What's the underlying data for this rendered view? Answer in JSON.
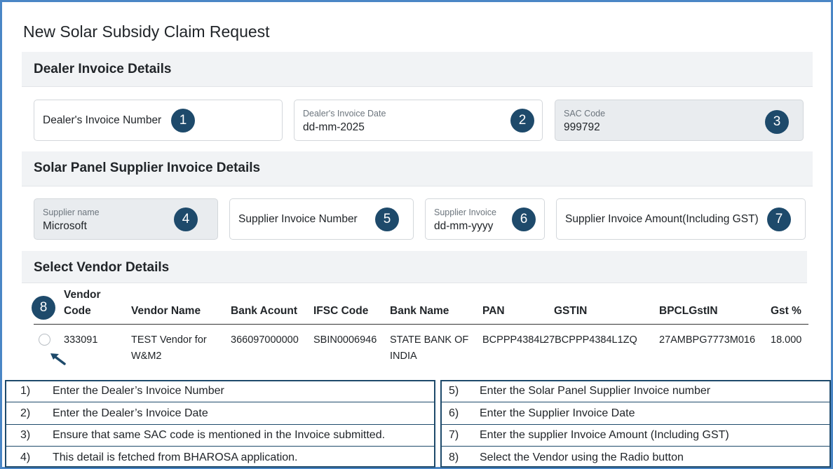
{
  "page": {
    "title": "New Solar Subsidy Claim Request"
  },
  "dealer": {
    "section_title": "Dealer Invoice Details",
    "invoice_number": {
      "placeholder": "Dealer's Invoice Number",
      "badge": "1"
    },
    "invoice_date": {
      "label": "Dealer's Invoice Date",
      "value": "dd-mm-2025",
      "badge": "2"
    },
    "sac_code": {
      "label": "SAC Code",
      "value": "999792",
      "badge": "3"
    }
  },
  "supplier": {
    "section_title": "Solar Panel Supplier Invoice Details",
    "name": {
      "label": "Supplier name",
      "value": "Microsoft",
      "badge": "4"
    },
    "invoice_number": {
      "placeholder": "Supplier Invoice Number",
      "badge": "5"
    },
    "invoice_date": {
      "label": "Supplier Invoice",
      "value": "dd-mm-yyyy",
      "badge": "6"
    },
    "invoice_amount": {
      "placeholder": "Supplier Invoice Amount(Including GST)",
      "badge": "7"
    }
  },
  "vendor": {
    "section_title": "Select Vendor Details",
    "badge": "8",
    "headers": [
      "Vendor",
      "Code",
      "Vendor Name",
      "Bank Acount",
      "IFSC Code",
      "Bank Name",
      "PAN",
      "GSTIN",
      "BPCLGstIN",
      "Gst %"
    ],
    "row": {
      "code": "333091",
      "name_line1": "TEST Vendor for",
      "name_line2": "W&M2",
      "bank_account": "366097000000",
      "ifsc": "SBIN0006946",
      "bank_line1": "STATE BANK OF",
      "bank_line2": "INDIA",
      "pan": "BCPPP4384L",
      "gstin": "27BCPPP4384L1ZQ",
      "bpcl_gstin": "27AMBPG7773M016",
      "gst_pct": "18.000"
    }
  },
  "notes_left": [
    {
      "num": "1)",
      "text": "Enter the Dealer’s Invoice Number"
    },
    {
      "num": "2)",
      "text": "Enter the Dealer’s Invoice Date"
    },
    {
      "num": "3)",
      "text": "Ensure that same SAC code is mentioned in the Invoice submitted."
    },
    {
      "num": "4)",
      "text": "This detail is fetched from BHAROSA application."
    }
  ],
  "notes_right": [
    {
      "num": "5)",
      "text": "Enter the Solar Panel Supplier Invoice number"
    },
    {
      "num": "6)",
      "text": "Enter the Supplier Invoice Date"
    },
    {
      "num": "7)",
      "text": "Enter the supplier Invoice Amount (Including GST)"
    },
    {
      "num": "8)",
      "text": "Select the Vendor using the Radio button"
    }
  ],
  "colors": {
    "badge": "#1e4a6b",
    "frame": "#4a86c5",
    "section_bg": "#f1f3f5",
    "readonly_bg": "#e9ecef"
  },
  "icons": {
    "pointer": "arrow-up-left-icon"
  }
}
